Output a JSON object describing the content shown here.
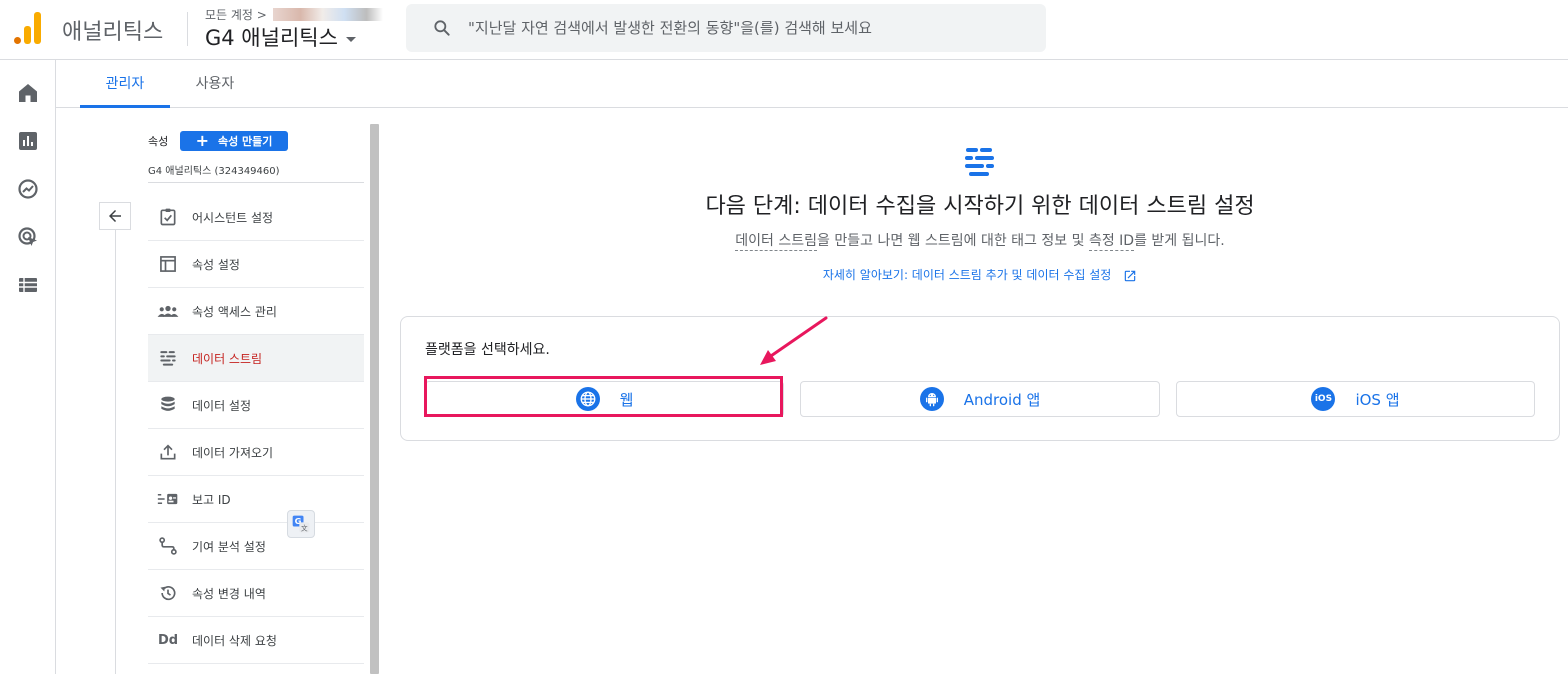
{
  "header": {
    "app_name": "애널리틱스",
    "breadcrumb_prefix": "모든 계정 >",
    "account_name": "G4 애널리틱스",
    "search_placeholder": "\"지난달 자연 검색에서 발생한 전환의 동향\"을(를) 검색해 보세요"
  },
  "rail": {
    "icons": [
      "home-icon",
      "reports-icon",
      "explore-icon",
      "advertising-icon",
      "configure-icon"
    ]
  },
  "tabs": [
    {
      "label": "관리자",
      "active": true
    },
    {
      "label": "사용자",
      "active": false
    }
  ],
  "property": {
    "label": "속성",
    "create_button": "속성 만들기",
    "name": "G4 애널리틱스 (324349460)"
  },
  "menu": [
    {
      "label": "어시스턴트 설정",
      "icon": "checklist-icon"
    },
    {
      "label": "속성 설정",
      "icon": "window-icon"
    },
    {
      "label": "속성 액세스 관리",
      "icon": "people-icon"
    },
    {
      "label": "데이터 스트림",
      "icon": "data-stream-icon",
      "selected": true
    },
    {
      "label": "데이터 설정",
      "icon": "database-icon"
    },
    {
      "label": "데이터 가져오기",
      "icon": "upload-icon"
    },
    {
      "label": "보고 ID",
      "icon": "reporting-id-icon"
    },
    {
      "label": "기여 분석 설정",
      "icon": "attribution-icon"
    },
    {
      "label": "속성 변경 내역",
      "icon": "history-icon"
    },
    {
      "label": "데이터 삭제 요청",
      "icon": "dd-icon",
      "icon_text": "Dd"
    }
  ],
  "main": {
    "headline": "다음 단계: 데이터 수집을 시작하기 위한 데이터 스트림 설정",
    "sub_term_1": "데이터 스트림",
    "sub_mid": "을 만들고 나면 웹 스트림에 대한 태그 정보 및 ",
    "sub_term_2": "측정 ID",
    "sub_end": "를 받게 됩니다.",
    "learn_link": "자세히 알아보기: 데이터 스트림 추가 및 데이터 수집 설정",
    "platform_title": "플랫폼을 선택하세요.",
    "platforms": [
      {
        "label": "웹",
        "icon": "globe-icon"
      },
      {
        "label": "Android 앱",
        "icon": "android-icon"
      },
      {
        "label": "iOS 앱",
        "icon": "ios-icon",
        "icon_text": "iOS"
      }
    ]
  },
  "colors": {
    "accent": "#1a73e8",
    "highlight": "#e8175d",
    "selected_text": "#c5221f",
    "logo_orange": "#f9ab00"
  }
}
